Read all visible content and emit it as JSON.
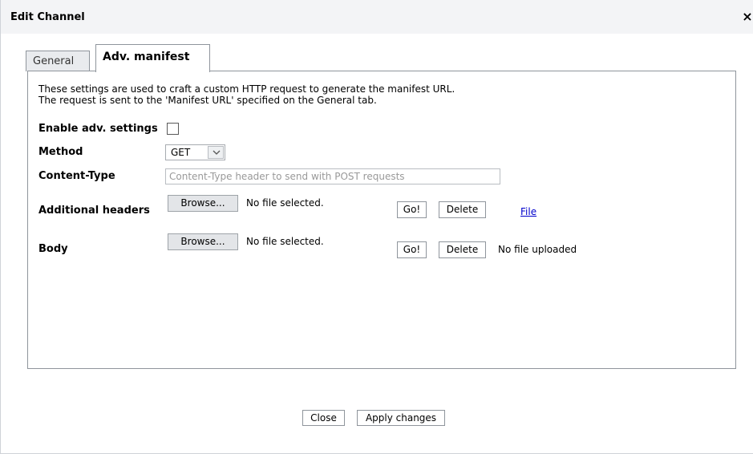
{
  "dialog": {
    "title": "Edit Channel",
    "close_glyph": "×"
  },
  "tabs": [
    {
      "label": "General",
      "active": false
    },
    {
      "label": "Adv. manifest",
      "active": true
    }
  ],
  "intro": {
    "line1": "These settings are used to craft a custom HTTP request to generate the manifest URL.",
    "line2": "The request is sent to the 'Manifest URL' specified on the General tab."
  },
  "form": {
    "enable_label": "Enable adv. settings",
    "enable_checked": false,
    "method_label": "Method",
    "method_value": "GET",
    "content_type_label": "Content-Type",
    "content_type_placeholder": "Content-Type header to send with POST requests",
    "headers_label": "Additional headers",
    "body_label": "Body"
  },
  "headers_row": {
    "browse_label": "Browse...",
    "file_status": "No file selected.",
    "go_label": "Go!",
    "delete_label": "Delete",
    "file_link": "File"
  },
  "body_row": {
    "browse_label": "Browse...",
    "file_status": "No file selected.",
    "go_label": "Go!",
    "delete_label": "Delete",
    "upload_status": "No file uploaded"
  },
  "footer": {
    "close_label": "Close",
    "apply_label": "Apply changes"
  },
  "colors": {
    "link": "#0000cc",
    "border": "#8f959c",
    "titlebar": "#f3f4f6"
  }
}
